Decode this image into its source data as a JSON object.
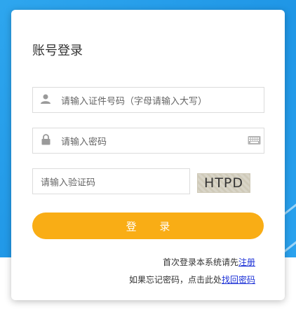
{
  "page": {
    "title": "账号登录"
  },
  "form": {
    "id_placeholder": "请输入证件号码（字母请输入大写）",
    "password_placeholder": "请输入密码",
    "captcha_placeholder": "请输入验证码",
    "captcha_text": "HTPD",
    "login_label": "登 录"
  },
  "links": {
    "register_prefix": "首次登录本系统请先",
    "register_label": "注册",
    "forgot_prefix": "如果忘记密码，点击此处",
    "forgot_label": "找回密码"
  },
  "colors": {
    "accent": "#f9ad15",
    "link": "#1a2fd6",
    "background": "#2196e8"
  },
  "icons": {
    "user": "user-icon",
    "lock": "lock-icon",
    "keyboard": "keyboard-icon"
  }
}
